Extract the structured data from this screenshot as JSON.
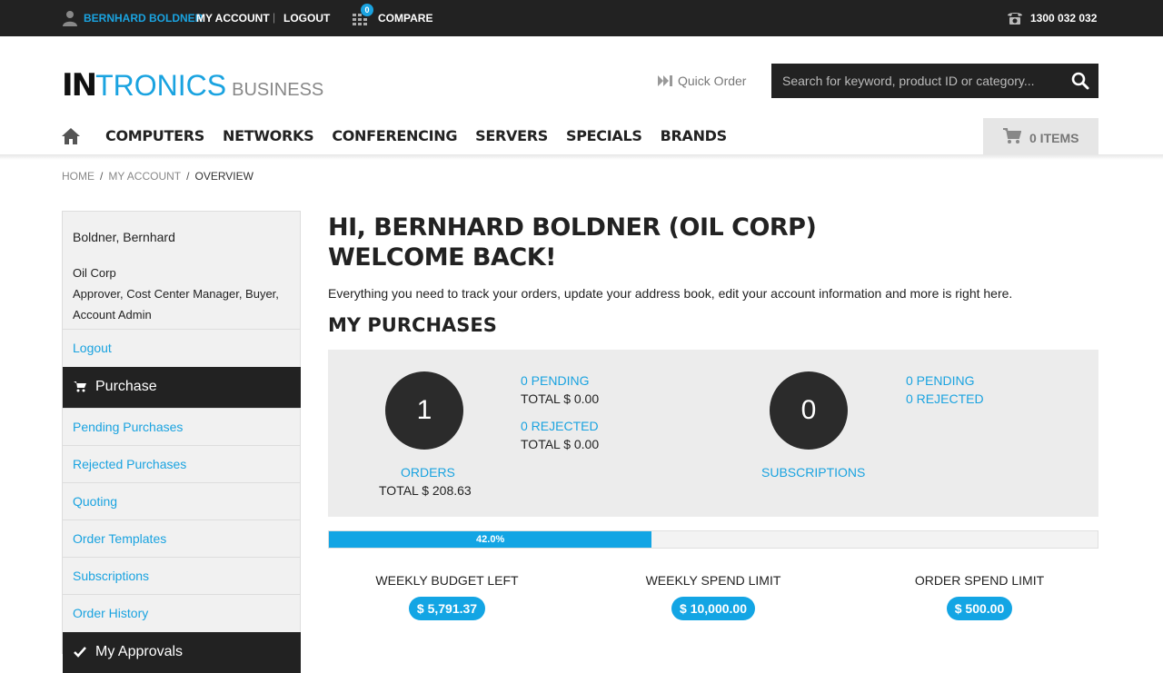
{
  "topbar": {
    "user_name": "BERNHARD BOLDNER",
    "my_account": "MY ACCOUNT",
    "separator": "|",
    "logout": "LOGOUT",
    "compare_count": "0",
    "compare": "COMPARE",
    "phone": "1300 032 032"
  },
  "logo": {
    "part1": "IN",
    "part2": "TRONICS",
    "part3": "BUSINESS"
  },
  "header": {
    "quick_order": "Quick Order",
    "search_placeholder": "Search for keyword, product ID or category...",
    "cart_label": "0 ITEMS"
  },
  "nav": {
    "items": [
      "COMPUTERS",
      "NETWORKS",
      "CONFERENCING",
      "SERVERS",
      "SPECIALS",
      "BRANDS"
    ]
  },
  "breadcrumb": {
    "home": "HOME",
    "account": "MY ACCOUNT",
    "current": "OVERVIEW",
    "sep": "/"
  },
  "sidebar": {
    "name": "Boldner, Bernhard",
    "company": "Oil Corp",
    "roles": "Approver, Cost Center Manager, Buyer, Account Admin",
    "logout": "Logout",
    "purchase_section": "Purchase",
    "purchase_links": [
      "Pending Purchases",
      "Rejected Purchases",
      "Quoting",
      "Order Templates",
      "Subscriptions",
      "Order History"
    ],
    "approvals_section": "My Approvals"
  },
  "main": {
    "greeting_line1": "HI, BERNHARD BOLDNER (OIL CORP)",
    "greeting_line2": "WELCOME BACK!",
    "intro": "Everything you need to track your orders, update your address book, edit your account information and more is right here.",
    "purchases_title": "MY PURCHASES",
    "orders": {
      "count": "1",
      "label": "ORDERS",
      "total": "TOTAL $ 208.63",
      "pending_label": "0 PENDING",
      "pending_total": "TOTAL $ 0.00",
      "rejected_label": "0 REJECTED",
      "rejected_total": "TOTAL $ 0.00"
    },
    "subscriptions": {
      "count": "0",
      "label": "SUBSCRIPTIONS",
      "pending_label": "0 PENDING",
      "rejected_label": "0 REJECTED"
    },
    "progress": {
      "value_percent": 42.0,
      "label": "42.0%"
    },
    "budget": [
      {
        "label": "WEEKLY BUDGET LEFT",
        "value": "$ 5,791.37"
      },
      {
        "label": "WEEKLY SPEND LIMIT",
        "value": "$ 10,000.00"
      },
      {
        "label": "ORDER SPEND LIMIT",
        "value": "$ 500.00"
      }
    ]
  },
  "colors": {
    "accent": "#1aa3e0",
    "dark": "#222222",
    "panel": "#ececec"
  }
}
